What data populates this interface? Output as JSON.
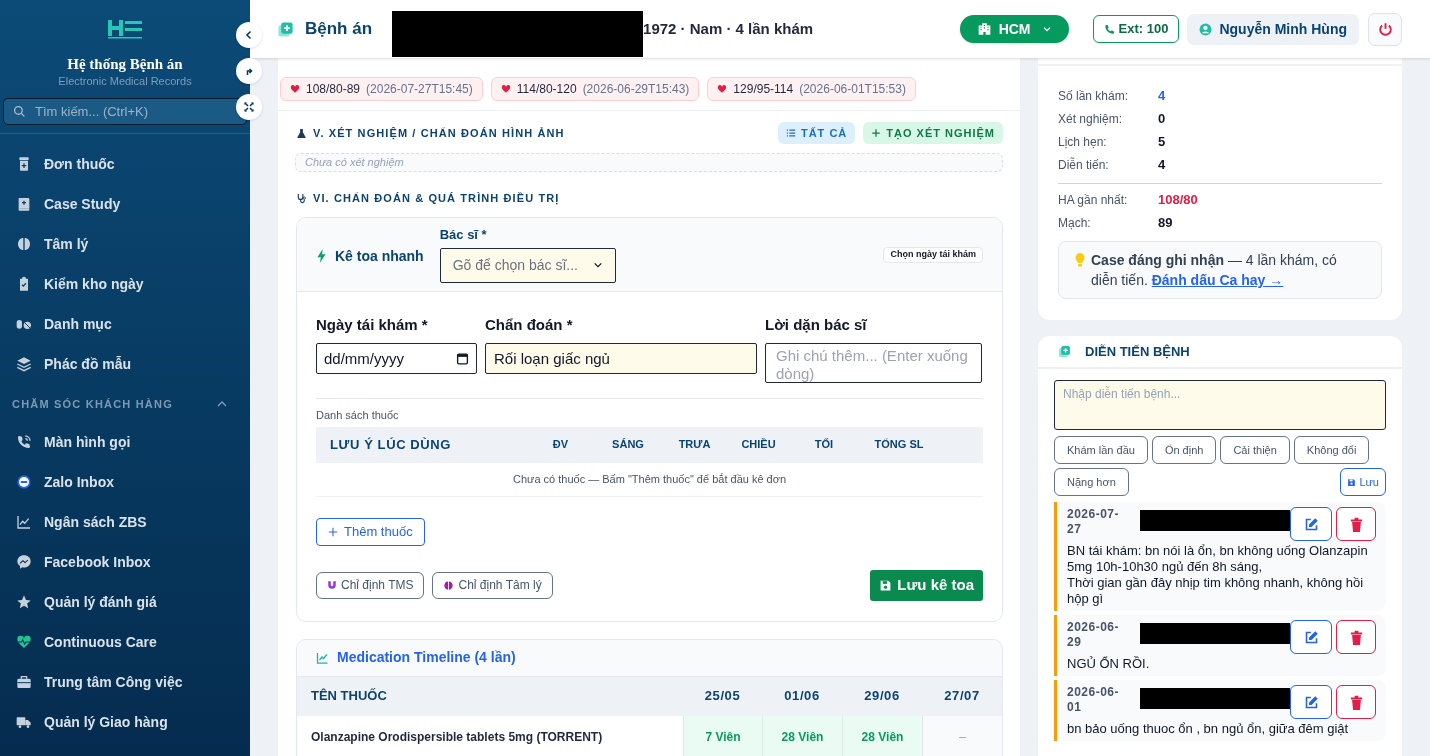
{
  "sidebar": {
    "title": "Hệ thống Bệnh án",
    "subtitle": "Electronic Medical Records",
    "search": {
      "placeholder": "Tìm kiếm... (Ctrl+K)"
    },
    "items": [
      {
        "label": "Đơn thuốc"
      },
      {
        "label": "Case Study"
      },
      {
        "label": "Tâm lý"
      },
      {
        "label": "Kiểm kho ngày"
      },
      {
        "label": "Danh mục"
      },
      {
        "label": "Phác đồ mẫu"
      }
    ],
    "section": {
      "label": "CHĂM SÓC KHÁCH HÀNG",
      "expanded": true,
      "items": [
        {
          "label": "Màn hình gọi"
        },
        {
          "label": "Zalo Inbox"
        },
        {
          "label": "Ngân sách ZBS"
        },
        {
          "label": "Facebook Inbox"
        },
        {
          "label": "Quản lý đánh giá"
        },
        {
          "label": "Continuous Care"
        },
        {
          "label": "Trung tâm Công việc"
        },
        {
          "label": "Quản lý Giao hàng"
        }
      ]
    }
  },
  "header": {
    "title": "Bệnh án",
    "patient_info": "1972 · Nam · 4 lần khám",
    "branch": "HCM",
    "extension": "Ext: 100",
    "user": "Nguyễn Minh Hùng"
  },
  "vitals": [
    {
      "reading": "108/80-89",
      "time": "(2026-07-27T15:45)"
    },
    {
      "reading": "114/80-120",
      "time": "(2026-06-29T15:43)"
    },
    {
      "reading": "129/95-114",
      "time": "(2026-06-01T15:53)"
    }
  ],
  "lab_section": {
    "title": "V. XÉT NGHIỆM / CHẨN ĐOÁN HÌNH ẢNH",
    "all_button": "TẤT CẢ",
    "create_button": "TẠO XÉT NGHIỆM",
    "empty": "Chưa có xét nghiệm"
  },
  "treatment_section": {
    "title": "VI. CHẨN ĐOÁN & QUÁ TRÌNH ĐIỀU TRỊ",
    "quick_rx": {
      "title": "Kê toa nhanh",
      "doctor_label": "Bác sĩ *",
      "doctor_placeholder": "Gõ để chọn bác sĩ...",
      "date_button": "Chọn ngày tái khám",
      "revisit_label": "Ngày tái khám *",
      "revisit_placeholder": "dd/mm/yyyy",
      "diagnosis_label": "Chẩn đoán *",
      "diagnosis_value": "Rối loạn giấc ngủ",
      "advice_label": "Lời dặn bác sĩ",
      "advice_placeholder": "Ghi chú thêm... (Enter xuống dòng)",
      "list_label": "Danh sách thuốc",
      "columns": [
        "LƯU Ý LÚC DÙNG",
        "ĐV",
        "SÁNG",
        "TRƯA",
        "CHIỀU",
        "TỐI",
        "TỔNG SL"
      ],
      "empty": "Chưa có thuốc — Bấm \"Thêm thuốc\" để bắt đầu kê đơn",
      "add_button": "Thêm thuốc",
      "tms_button": "Chỉ định TMS",
      "psy_button": "Chỉ định Tâm lý",
      "save_button": "Lưu kê toa"
    }
  },
  "medication_timeline": {
    "title": "Medication Timeline (4 lần)",
    "columns": [
      "TÊN THUỐC",
      "25/05",
      "01/06",
      "29/06",
      "27/07"
    ],
    "rows": [
      {
        "cells": [
          {
            "text": "Olanzapine Orodispersible tablets 5mg (TORRENT)",
            "kind": "name"
          },
          {
            "text": "7 Viên",
            "kind": "dose"
          },
          {
            "text": "28 Viên",
            "kind": "dose"
          },
          {
            "text": "28 Viên",
            "kind": "dose"
          },
          {
            "text": "–",
            "kind": "none"
          }
        ]
      }
    ]
  },
  "summary": {
    "stats": [
      {
        "label": "Số lần khám:",
        "value": "4",
        "color": "#2563eb"
      },
      {
        "label": "Xét nghiệm:",
        "value": "0",
        "color": "#111827"
      },
      {
        "label": "Lịch hẹn:",
        "value": "5",
        "color": "#111827"
      },
      {
        "label": "Diễn tiến:",
        "value": "4",
        "color": "#111827"
      }
    ],
    "vitals": [
      {
        "label": "HA gần nhất:",
        "value": "108/80",
        "color": "#e11d48"
      },
      {
        "label": "Mạch:",
        "value": "89",
        "color": "#111827"
      }
    ],
    "note": {
      "text": "**Case đáng ghi nhận** — 4 lần khám, có diễn tiến.",
      "link": "Đánh dấu Ca hay →"
    }
  },
  "progress": {
    "title": "DIỄN TIẾN BỆNH",
    "placeholder": "Nhập diễn tiến bệnh...",
    "tags": [
      "Khám lần đầu",
      "Ổn định",
      "Cải thiện",
      "Không đổi",
      "Nặng hơn"
    ],
    "save_button": "Lưu",
    "entries": [
      {
        "date": "2026-07-27",
        "note": "BN tái khám: bn nói là ổn, bn không uống Olanzapin 5mg 10h-10h30 ngủ đến 8h sáng,\nThời gian gần đây nhịp tim không nhanh, không hồi hộp gì"
      },
      {
        "date": "2026-06-29",
        "note": "NGỦ ỔN RỒI."
      },
      {
        "date": "2026-06-01",
        "note": "bn bảo uống thuoc ổn , bn ngủ ổn, giữa đêm giật"
      }
    ]
  }
}
